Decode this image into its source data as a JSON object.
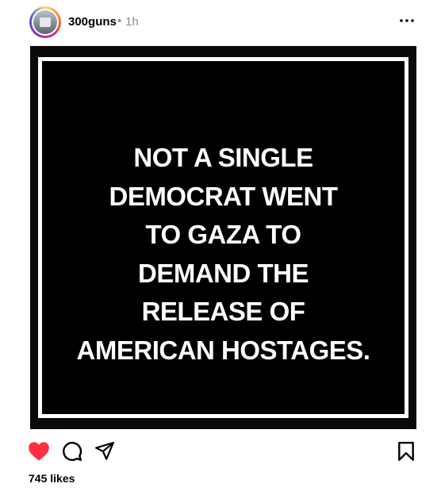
{
  "post": {
    "username": "300guns",
    "separator": "•",
    "time": "1h",
    "image_text_lines": [
      "NOT A SINGLE",
      "DEMOCRAT WENT",
      "TO GAZA TO",
      "DEMAND THE",
      "RELEASE OF",
      "AMERICAN HOSTAGES."
    ],
    "likes": "745 likes"
  },
  "icons": {
    "more": "more-horizontal-icon",
    "like": "heart-filled-icon",
    "comment": "comment-bubble-icon",
    "share": "paper-plane-icon",
    "save": "bookmark-icon"
  },
  "colors": {
    "like_red": "#ff3040",
    "muted_text": "#8e8e8e",
    "image_bg": "#000000"
  }
}
